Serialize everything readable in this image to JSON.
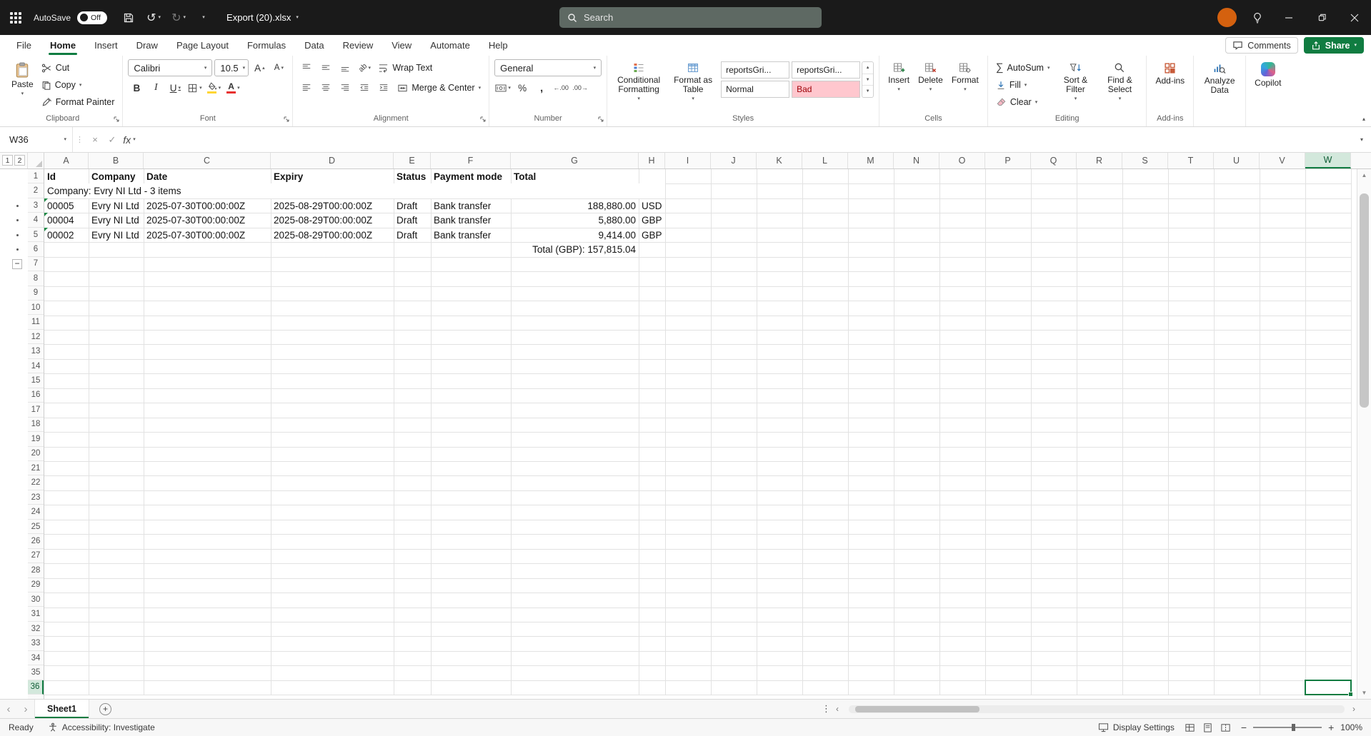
{
  "title_bar": {
    "autosave_label": "AutoSave",
    "autosave_state": "Off",
    "file_name": "Export (20).xlsx",
    "search_placeholder": "Search"
  },
  "menu": {
    "tabs": [
      "File",
      "Home",
      "Insert",
      "Draw",
      "Page Layout",
      "Formulas",
      "Data",
      "Review",
      "View",
      "Automate",
      "Help"
    ],
    "comments_label": "Comments",
    "share_label": "Share"
  },
  "ribbon": {
    "clipboard": {
      "group_label": "Clipboard",
      "paste_label": "Paste",
      "cut_label": "Cut",
      "copy_label": "Copy",
      "format_painter_label": "Format Painter"
    },
    "font": {
      "group_label": "Font",
      "family": "Calibri",
      "size": "10.5"
    },
    "alignment": {
      "group_label": "Alignment",
      "wrap_text_label": "Wrap Text",
      "merge_center_label": "Merge & Center"
    },
    "number": {
      "group_label": "Number",
      "format": "General"
    },
    "styles": {
      "group_label": "Styles",
      "conditional_label": "Conditional Formatting",
      "format_table_label": "Format as Table",
      "gallery": [
        "reportsGri...",
        "reportsGri...",
        "Normal",
        "Bad"
      ]
    },
    "cells": {
      "group_label": "Cells",
      "insert_label": "Insert",
      "delete_label": "Delete",
      "format_label": "Format"
    },
    "editing": {
      "group_label": "Editing",
      "autosum_label": "AutoSum",
      "fill_label": "Fill",
      "clear_label": "Clear",
      "sort_label": "Sort & Filter",
      "find_label": "Find & Select"
    },
    "addins": {
      "group_label": "Add-ins",
      "button_label": "Add-ins"
    },
    "analyze_label": "Analyze Data",
    "copilot_label": "Copilot"
  },
  "formula_bar": {
    "name_box": "W36",
    "fx_label": "fx"
  },
  "grid": {
    "columns": [
      "A",
      "B",
      "C",
      "D",
      "E",
      "F",
      "G",
      "H",
      "I",
      "J",
      "K",
      "L",
      "M",
      "N",
      "O",
      "P",
      "Q",
      "R",
      "S",
      "T",
      "U",
      "V",
      "W"
    ],
    "rows": 36,
    "selection": {
      "col": "W",
      "row": 36
    },
    "outline": {
      "levels": [
        "1",
        "2"
      ],
      "dot_rows": [
        3,
        4,
        5,
        6
      ],
      "collapse_row": 7
    },
    "cells": [
      {
        "r": 1,
        "c": "A",
        "text": "Id",
        "bold": true
      },
      {
        "r": 1,
        "c": "B",
        "text": "Company",
        "bold": true
      },
      {
        "r": 1,
        "c": "C",
        "text": "Date",
        "bold": true
      },
      {
        "r": 1,
        "c": "D",
        "text": "Expiry",
        "bold": true
      },
      {
        "r": 1,
        "c": "E",
        "text": "Status",
        "bold": true
      },
      {
        "r": 1,
        "c": "F",
        "text": "Payment mode",
        "bold": true
      },
      {
        "r": 1,
        "c": "G",
        "text": "Total",
        "bold": true
      },
      {
        "r": 2,
        "c": "A",
        "text": "Company: Evry NI Ltd - 3 items",
        "span_to": "H"
      },
      {
        "r": 3,
        "c": "A",
        "text": "00005",
        "flag": true
      },
      {
        "r": 3,
        "c": "B",
        "text": "Evry NI Ltd"
      },
      {
        "r": 3,
        "c": "C",
        "text": "2025-07-30T00:00:00Z"
      },
      {
        "r": 3,
        "c": "D",
        "text": "2025-08-29T00:00:00Z"
      },
      {
        "r": 3,
        "c": "E",
        "text": "Draft"
      },
      {
        "r": 3,
        "c": "F",
        "text": "Bank transfer"
      },
      {
        "r": 3,
        "c": "G",
        "text": "188,880.00",
        "align": "right"
      },
      {
        "r": 3,
        "c": "H",
        "text": "USD"
      },
      {
        "r": 4,
        "c": "A",
        "text": "00004",
        "flag": true
      },
      {
        "r": 4,
        "c": "B",
        "text": "Evry NI Ltd"
      },
      {
        "r": 4,
        "c": "C",
        "text": "2025-07-30T00:00:00Z"
      },
      {
        "r": 4,
        "c": "D",
        "text": "2025-08-29T00:00:00Z"
      },
      {
        "r": 4,
        "c": "E",
        "text": "Draft"
      },
      {
        "r": 4,
        "c": "F",
        "text": "Bank transfer"
      },
      {
        "r": 4,
        "c": "G",
        "text": "5,880.00",
        "align": "right"
      },
      {
        "r": 4,
        "c": "H",
        "text": "GBP"
      },
      {
        "r": 5,
        "c": "A",
        "text": "00002",
        "flag": true
      },
      {
        "r": 5,
        "c": "B",
        "text": "Evry NI Ltd"
      },
      {
        "r": 5,
        "c": "C",
        "text": "2025-07-30T00:00:00Z"
      },
      {
        "r": 5,
        "c": "D",
        "text": "2025-08-29T00:00:00Z"
      },
      {
        "r": 5,
        "c": "E",
        "text": "Draft"
      },
      {
        "r": 5,
        "c": "F",
        "text": "Bank transfer"
      },
      {
        "r": 5,
        "c": "G",
        "text": "9,414.00",
        "align": "right"
      },
      {
        "r": 5,
        "c": "H",
        "text": "GBP"
      },
      {
        "r": 6,
        "c": "G",
        "text": "Total (GBP): 157,815.04",
        "align": "right"
      }
    ]
  },
  "sheet_bar": {
    "active_tab": "Sheet1"
  },
  "status_bar": {
    "ready_label": "Ready",
    "accessibility_label": "Accessibility: Investigate",
    "display_settings_label": "Display Settings",
    "zoom_level": "100%"
  }
}
